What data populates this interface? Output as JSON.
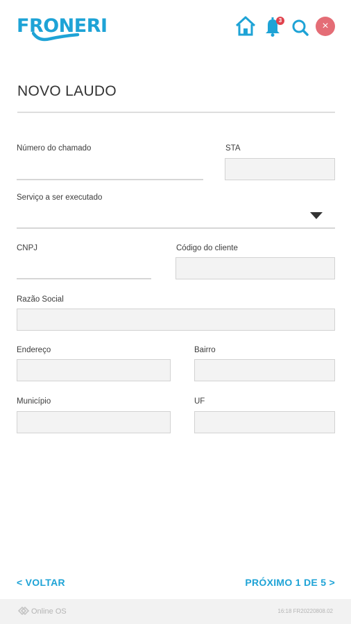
{
  "header": {
    "logo_text": "FRONERI",
    "notification_count": "3",
    "close_glyph": "×",
    "icons": [
      "home-icon",
      "bell-icon",
      "search-icon",
      "close-icon"
    ],
    "accent_color": "#1ea3d6"
  },
  "page": {
    "title": "NOVO LAUDO"
  },
  "form": {
    "numero_chamado": {
      "label": "Número do chamado",
      "value": ""
    },
    "sta": {
      "label": "STA",
      "value": ""
    },
    "servico": {
      "label": "Serviço a ser executado",
      "value": ""
    },
    "cnpj": {
      "label": "CNPJ",
      "value": ""
    },
    "codigo_cliente": {
      "label": "Código do cliente",
      "value": ""
    },
    "razao_social": {
      "label": "Razão Social",
      "value": ""
    },
    "endereco": {
      "label": "Endereço",
      "value": ""
    },
    "bairro": {
      "label": "Bairro",
      "value": ""
    },
    "municipio": {
      "label": "Município",
      "value": ""
    },
    "uf": {
      "label": "UF",
      "value": ""
    }
  },
  "nav": {
    "back_label": "< VOLTAR",
    "next_label": "PRÓXIMO 1 DE 5 >"
  },
  "footer": {
    "brand": "Online OS",
    "version": "16:18 FR20220808.02"
  }
}
